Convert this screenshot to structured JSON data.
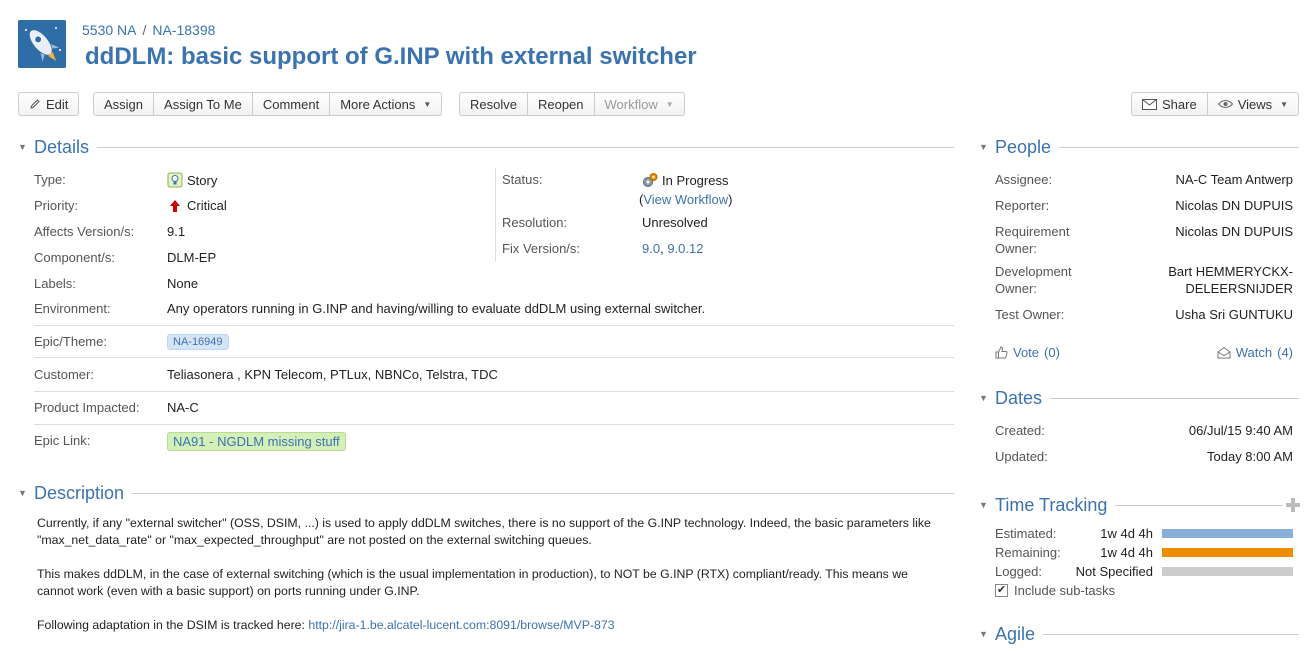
{
  "breadcrumb": {
    "project": "5530 NA",
    "separator": "/",
    "issue_key": "NA-18398"
  },
  "title": "ddDLM: basic support of G.INP with external switcher",
  "toolbar": {
    "edit": "Edit",
    "assign": "Assign",
    "assign_to_me": "Assign To Me",
    "comment": "Comment",
    "more_actions": "More Actions",
    "resolve": "Resolve",
    "reopen": "Reopen",
    "workflow": "Workflow",
    "share": "Share",
    "views": "Views"
  },
  "details": {
    "heading": "Details",
    "type": {
      "label": "Type:",
      "value": "Story"
    },
    "priority": {
      "label": "Priority:",
      "value": "Critical"
    },
    "affects": {
      "label": "Affects Version/s:",
      "value": "9.1"
    },
    "components": {
      "label": "Component/s:",
      "value": "DLM-EP"
    },
    "labels": {
      "label": "Labels:",
      "value": "None"
    },
    "environment": {
      "label": "Environment:",
      "value": "Any operators running in G.INP and having/willing to evaluate ddDLM using external switcher."
    },
    "status": {
      "label": "Status:",
      "value": "In Progress",
      "view_workflow": "View Workflow"
    },
    "resolution": {
      "label": "Resolution:",
      "value": "Unresolved"
    },
    "fix_versions": {
      "label": "Fix Version/s:",
      "v1": "9.0",
      "v2": "9.0.12"
    },
    "epic_theme": {
      "label": "Epic/Theme:",
      "value": "NA-16949"
    },
    "customer": {
      "label": "Customer:",
      "value": "Teliasonera , KPN Telecom, PTLux, NBNCo, Telstra, TDC"
    },
    "product_impacted": {
      "label": "Product Impacted:",
      "value": "NA-C"
    },
    "epic_link": {
      "label": "Epic Link:",
      "value": "NA91 - NGDLM missing stuff"
    }
  },
  "description": {
    "heading": "Description",
    "p1": "Currently, if any \"external switcher\" (OSS, DSIM, ...) is used to apply ddDLM switches, there is no support of the G.INP technology. Indeed, the basic parameters like \"max_net_data_rate\" or \"max_expected_throughput\" are not posted on the external switching queues.",
    "p2": "This makes ddDLM, in the case of external switching (which is the usual implementation in production), to NOT be G.INP (RTX) compliant/ready. This means we cannot work (even with a basic support) on ports running under G.INP.",
    "p3_prefix": "Following adaptation in the DSIM is tracked here: ",
    "p3_link": "http://jira-1.be.alcatel-lucent.com:8091/browse/MVP-873"
  },
  "people": {
    "heading": "People",
    "assignee": {
      "label": "Assignee:",
      "value": "NA-C Team Antwerp"
    },
    "reporter": {
      "label": "Reporter:",
      "value": "Nicolas DN DUPUIS"
    },
    "req_owner": {
      "label1": "Requirement",
      "label2": "Owner:",
      "value": "Nicolas DN DUPUIS"
    },
    "dev_owner": {
      "label1": "Development",
      "label2": "Owner:",
      "value1": "Bart HEMMERYCKX-",
      "value2": "DELEERSNIJDER"
    },
    "test_owner": {
      "label": "Test Owner:",
      "value": "Usha Sri GUNTUKU"
    },
    "vote": "Vote",
    "vote_count": "(0)",
    "watch": "Watch",
    "watch_count": "(4)"
  },
  "dates": {
    "heading": "Dates",
    "created": {
      "label": "Created:",
      "value": "06/Jul/15 9:40 AM"
    },
    "updated": {
      "label": "Updated:",
      "value": "Today 8:00 AM"
    }
  },
  "time_tracking": {
    "heading": "Time Tracking",
    "estimated": {
      "label": "Estimated:",
      "value": "1w 4d 4h",
      "fill": 1.0,
      "color": "#89afd7"
    },
    "remaining": {
      "label": "Remaining:",
      "value": "1w 4d 4h",
      "fill": 1.0,
      "color": "#ec8e00"
    },
    "logged": {
      "label": "Logged:",
      "value": "Not Specified",
      "fill": 0.0,
      "color": "#cccccc"
    },
    "include_subtasks": "Include sub-tasks"
  },
  "agile": {
    "heading": "Agile"
  },
  "colors": {
    "link": "#3b73af",
    "heading": "#3b73af",
    "priority_critical": "#cc0000"
  }
}
